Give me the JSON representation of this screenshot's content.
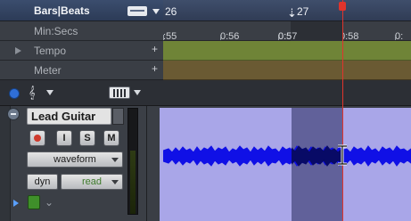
{
  "rulers": {
    "bars_beats": {
      "label": "Bars|Beats",
      "ticks": [
        "26",
        "27"
      ]
    },
    "min_secs": {
      "label": "Min:Secs",
      "ticks": [
        ":55",
        "0:56",
        "0:57",
        "0:58",
        "0:"
      ]
    },
    "tempo": {
      "label": "Tempo",
      "plus": "+"
    },
    "meter": {
      "label": "Meter",
      "plus": "+"
    }
  },
  "track": {
    "name": "Lead Guitar",
    "buttons": {
      "input": "I",
      "solo": "S",
      "mute": "M"
    },
    "view": "waveform",
    "automation": {
      "param": "dyn",
      "mode": "read"
    }
  },
  "colors": {
    "clip_bg": "#a9a6e8",
    "selection": "#61619a",
    "waveform": "#1010e6",
    "waveform_selected": "#080a66",
    "playhead": "#e0342c",
    "tempo_ruler": "#6f8437",
    "meter_ruler": "#6a5a33"
  },
  "icons": [
    "ruler-view-icon",
    "tool-icon",
    "waveform-selected-icon",
    "i-beam-cursor-icon",
    "playhead-marker-icon"
  ]
}
